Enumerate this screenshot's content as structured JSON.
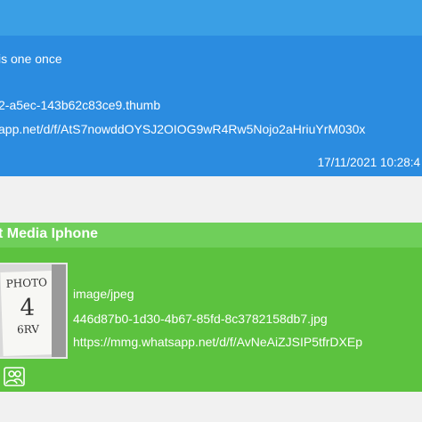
{
  "message_1": {
    "body_fragment": "is one once",
    "filename_fragment": "2-a5ec-143b62c83ce9.thumb",
    "url_fragment": "app.net/d/f/AtS7nowddOYSJ2OIOG9wR4Rw5Nojo2aHriuYrM030x",
    "timestamp": "17/11/2021 10:28:4"
  },
  "message_2": {
    "sender": "t Media Iphone",
    "thumbnail_text": [
      "PHOTO",
      "4",
      "6RV"
    ],
    "mime_type": "image/jpeg",
    "filename": "446d87b0-1d30-4b67-85fd-8c3782158db7.jpg",
    "url": "https://mmg.whatsapp.net/d/f/AvNeAiZJSIP5tfrDXEp",
    "contact_icon": "contact-icon"
  },
  "colors": {
    "blue_header": "#3a9fe5",
    "blue_card": "#2b8ce0",
    "green_header": "#6fcf5a",
    "green_card": "#5cc23f",
    "background": "#f0f0f0"
  }
}
